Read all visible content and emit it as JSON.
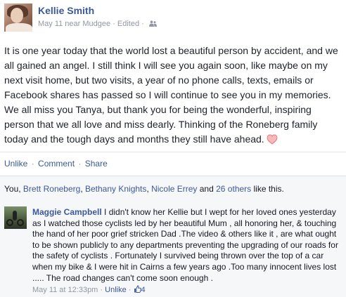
{
  "post": {
    "author": "Kellie Smith",
    "meta": "May 11 near Mudgee · Edited ·",
    "audience_icon": "friends-icon",
    "body": "It is one year today that the world lost a beautiful person by accident, and we all gained an angel. I still think I will see you again soon, like maybe on my next visit home, but two visits, a year of no phone calls, texts, emails or Facebook shares has passed so I will continue to see you in my memories. We all miss you Tanya, but thank you for being the wonderful, inspiring person that we all love and miss dearly. Thinking of the Roneberg family today and the tough days and months they still have ahead.",
    "emoji_icon": "heart-icon"
  },
  "actions": {
    "unlike": "Unlike",
    "comment": "Comment",
    "share": "Share",
    "separator": "·"
  },
  "likes": {
    "prefix": "You, ",
    "person1": "Brett Roneberg",
    "sep1": ", ",
    "person2": "Bethany Knights",
    "sep2": ", ",
    "person3": "Nicole Errey",
    "and": " and ",
    "others": "26 others",
    "suffix": " like this."
  },
  "comment": {
    "author": "Maggie Campbell",
    "text": " I didn't know her Kellie but I wept for her loved ones yesterday as I watched those cyclists led by her beautiful Mum , all honoring her, & touching the hand of her poor grief stricken Dad .The video & others like it , are what ought to be shown publicly to any departments preventing the upgrading of our roads for the safety of cyclists . Fortunately I survived being thrown over the top of a car when my bike & I were hit in Cairns a few years ago .Too many innocent lives lost ..... The road changes can't come soon enough .",
    "timestamp": "May 11 at 12:33pm",
    "separator": " · ",
    "unlike": "Unlike",
    "like_count": "4",
    "like_icon": "thumbs-up-icon"
  },
  "colors": {
    "link": "#3b5998",
    "meta": "#9197a3",
    "text": "#1d2129",
    "panel_bg": "#f6f7f8",
    "heart": "#e87b7b"
  }
}
